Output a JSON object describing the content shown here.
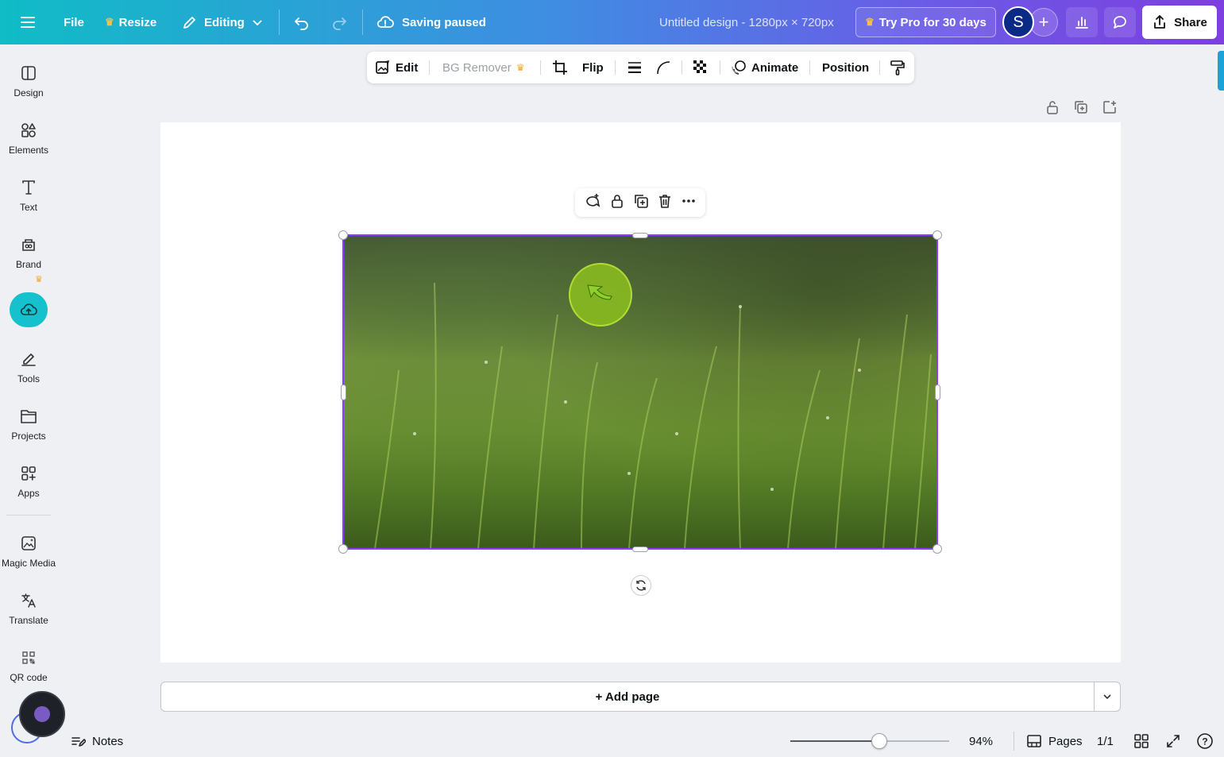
{
  "topbar": {
    "file_label": "File",
    "resize_label": "Resize",
    "editing_label": "Editing",
    "saving_status": "Saving paused",
    "design_title": "Untitled design - 1280px × 720px",
    "pro_label": "Try Pro for 30 days",
    "avatar_initial": "S",
    "plus_label": "+",
    "share_label": "Share"
  },
  "sidebar": {
    "items": [
      {
        "label": "Design",
        "icon": "design-icon"
      },
      {
        "label": "Elements",
        "icon": "elements-icon"
      },
      {
        "label": "Text",
        "icon": "text-icon"
      },
      {
        "label": "Brand",
        "icon": "brand-icon"
      },
      {
        "label": "",
        "icon": "uploads-icon"
      },
      {
        "label": "Tools",
        "icon": "tools-icon"
      },
      {
        "label": "Projects",
        "icon": "projects-icon"
      },
      {
        "label": "Apps",
        "icon": "apps-icon"
      },
      {
        "label": "Magic Media",
        "icon": "magic-media-icon"
      },
      {
        "label": "Translate",
        "icon": "translate-icon"
      },
      {
        "label": "QR code",
        "icon": "qr-code-icon"
      }
    ]
  },
  "context_toolbar": {
    "edit_label": "Edit",
    "bg_remover_label": "BG Remover",
    "flip_label": "Flip",
    "animate_label": "Animate",
    "position_label": "Position"
  },
  "canvas": {
    "add_page_label": "+ Add page"
  },
  "bottom": {
    "notes_label": "Notes",
    "zoom_value": "94%",
    "zoom_fraction": 0.56,
    "pages_label": "Pages",
    "page_counter": "1/1",
    "help_label": "?"
  },
  "colors": {
    "accent": "#8b3dff",
    "active_sidebar": "#15c1cd",
    "crown": "#f5a623"
  }
}
